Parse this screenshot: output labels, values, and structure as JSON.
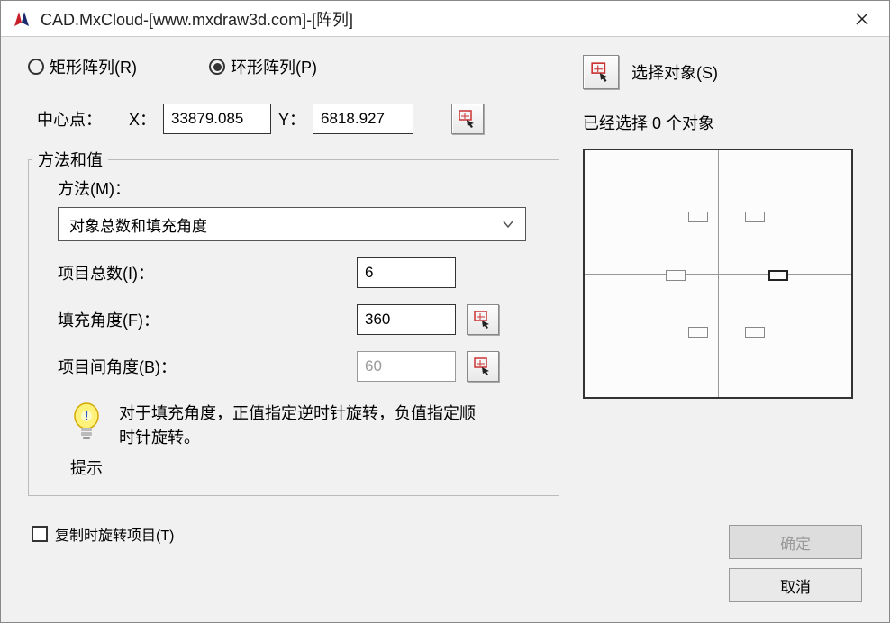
{
  "title": "CAD.MxCloud-[www.mxdraw3d.com]-[阵列]",
  "array_type": {
    "rect_label": "矩形阵列(R)",
    "polar_label": "环形阵列(P)",
    "selected": "polar"
  },
  "center": {
    "label": "中心点：",
    "x_label": "X：",
    "x_value": "33879.085",
    "y_label": "Y：",
    "y_value": "6818.927"
  },
  "method_group": {
    "title": "方法和值",
    "method_label": "方法(M)：",
    "method_value": "对象总数和填充角度",
    "total_label": "项目总数(I)：",
    "total_value": "6",
    "fill_angle_label": "填充角度(F)：",
    "fill_angle_value": "360",
    "between_angle_label": "项目间角度(B)：",
    "between_angle_value": "60",
    "tip_text": "对于填充角度，正值指定逆时针旋转，负值指定顺时针旋转。",
    "tip_label": "提示"
  },
  "rotate_copy_label": "复制时旋转项目(T)",
  "select": {
    "button_label": "选择对象(S)",
    "status_prefix": "已经选择 ",
    "status_count": "0",
    "status_suffix": " 个对象"
  },
  "buttons": {
    "ok": "确定",
    "cancel": "取消"
  },
  "icons": {
    "pick": "pick-point-icon",
    "bulb": "lightbulb-icon",
    "chevron": "chevron-down-icon"
  }
}
